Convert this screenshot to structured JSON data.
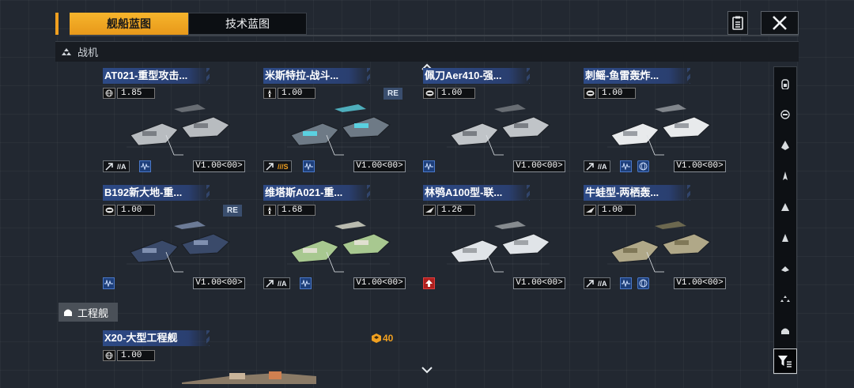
{
  "tabs": [
    {
      "label": "舰船蓝图",
      "active": true
    },
    {
      "label": "技术蓝图",
      "active": false
    }
  ],
  "sections": {
    "fighter": "战机",
    "engineering": "工程舰"
  },
  "cards": [
    {
      "title": "AT021-重型攻击...",
      "stat_icon": "globe-icon",
      "stat": "1.85",
      "re": "",
      "trait_grade": "//A",
      "version": "V1.00<00>"
    },
    {
      "title": "米斯特拉-战斗...",
      "stat_icon": "rocket-icon",
      "stat": "1.00",
      "re": "RE",
      "trait_grade": "///S",
      "version": "V1.00<00>"
    },
    {
      "title": "佩刀Aer410-强...",
      "stat_icon": "shield-icon",
      "stat": "1.00",
      "re": "",
      "trait_grade": "",
      "version": "V1.00<00>"
    },
    {
      "title": "刺鳐-鱼雷轰炸...",
      "stat_icon": "shield-icon",
      "stat": "1.00",
      "re": "",
      "trait_grade": "//A",
      "version": "V1.00<00>"
    },
    {
      "title": "B192新大地-重...",
      "stat_icon": "shield-icon",
      "stat": "1.00",
      "re": "RE",
      "trait_grade": "",
      "version": "V1.00<00>"
    },
    {
      "title": "维塔斯A021-重...",
      "stat_icon": "rocket-icon",
      "stat": "1.68",
      "re": "",
      "trait_grade": "//A",
      "version": "V1.00<00>"
    },
    {
      "title": "林鸮A100型-联...",
      "stat_icon": "wing-icon",
      "stat": "1.26",
      "re": "",
      "trait_grade": "",
      "version": "V1.00<00>"
    },
    {
      "title": "牛蛙型-两栖轰...",
      "stat_icon": "wing-icon",
      "stat": "1.00",
      "re": "",
      "trait_grade": "//A",
      "version": "V1.00<00>"
    }
  ],
  "engineering_card": {
    "title": "X20-大型工程舰",
    "stat": "1.00",
    "cost": "40"
  },
  "colors": {
    "accent": "#f0a020",
    "title_blue": "#2d4a86",
    "background": "#222831"
  },
  "sidebar_icons": [
    "ship-class-1-icon",
    "ship-class-2-icon",
    "ship-class-3-icon",
    "ship-class-4-icon",
    "ship-class-5-icon",
    "ship-class-6-icon",
    "ship-class-7-icon",
    "ship-class-8-icon",
    "ship-class-9-icon"
  ]
}
